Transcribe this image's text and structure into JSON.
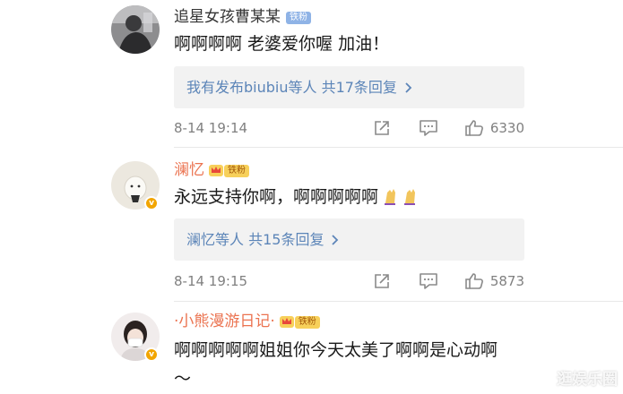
{
  "comments": [
    {
      "username": "追星女孩曹某某",
      "badge": "铁粉",
      "content": "啊啊啊啊 老婆爱你喔 加油！",
      "reply_summary": "我有发布biubiu等人 共17条回复",
      "time": "8-14 19:14",
      "likes": "6330"
    },
    {
      "username": "澜忆",
      "badge": "铁粉",
      "content": "永远支持你啊，啊啊啊啊啊",
      "reply_summary": "澜忆等人 共15条回复",
      "time": "8-14 19:15",
      "likes": "5873"
    },
    {
      "username": "·小熊漫游日记·",
      "badge": "铁粉",
      "content_line1": "啊啊啊啊啊姐姐你今天太美了啊啊是心动啊",
      "content_line2": "～"
    }
  ],
  "watermark": "逛娱乐圈",
  "colors": {
    "username_orange": "#eb7350",
    "reply_link": "#5c85b8",
    "reply_bg": "#f2f2f2",
    "meta_gray": "#808080"
  },
  "icons": [
    "share-icon",
    "comment-icon",
    "like-icon",
    "crown-icon",
    "verified-icon",
    "chevron-right-icon"
  ]
}
